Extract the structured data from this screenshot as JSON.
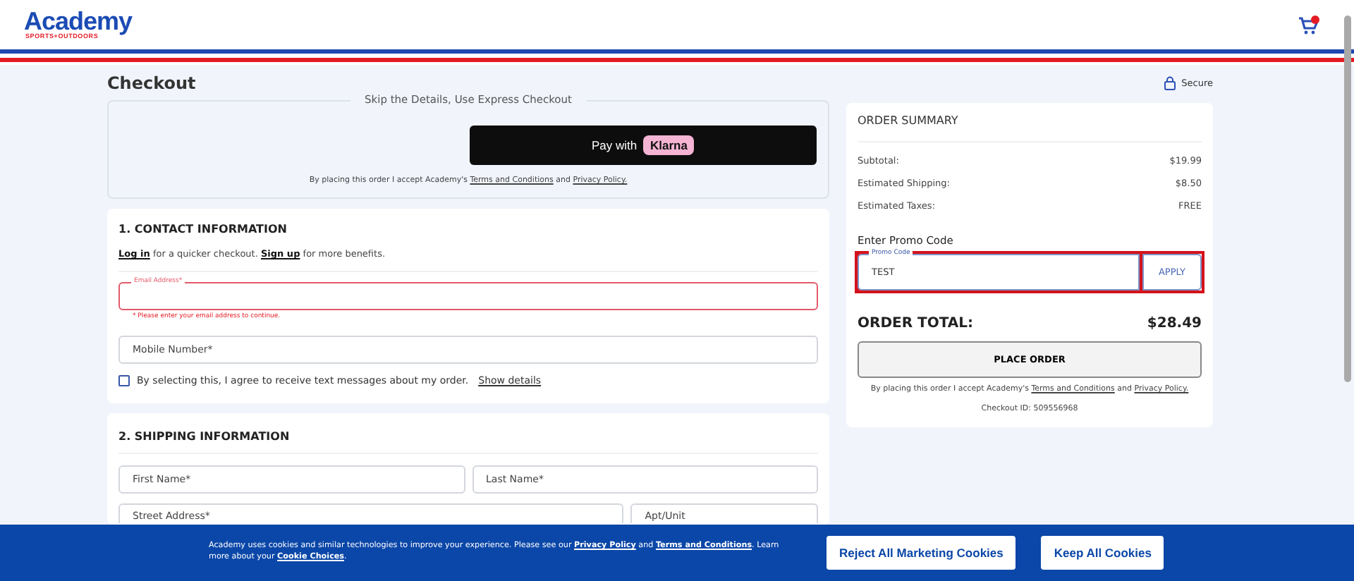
{
  "header": {
    "logo": "Academy",
    "logo_tagline": "SPORTS+OUTDOORS"
  },
  "page_title": "Checkout",
  "secure_label": "Secure",
  "express": {
    "legend": "Skip the Details, Use Express Checkout",
    "pay_label": "Pay with",
    "pay_brand": "Klarna",
    "legal_before": "By placing this order I accept Academy's",
    "terms": "Terms and Conditions",
    "and": "and",
    "privacy": "Privacy Policy."
  },
  "contact": {
    "heading": "1. CONTACT INFORMATION",
    "login": "Log in",
    "login_rest": "for a quicker checkout.",
    "signup": "Sign up",
    "signup_rest": "for more benefits.",
    "email": {
      "label": "Email Address*",
      "error": true,
      "error_text": "* Please enter your email address to continue."
    },
    "mobile": {
      "placeholder": "Mobile Number*"
    },
    "sms": {
      "label": "By selecting this, I agree to receive text messages about my order.",
      "checked": false,
      "details": "Show details"
    }
  },
  "shipping": {
    "heading": "2. SHIPPING INFORMATION",
    "rows": [
      [
        {
          "placeholder": "First Name*"
        },
        {
          "placeholder": "Last Name*"
        }
      ],
      [
        {
          "placeholder": "Street Address*"
        },
        {
          "placeholder": "Apt/Unit"
        }
      ]
    ]
  },
  "summary": {
    "title": "ORDER SUMMARY",
    "lines": [
      {
        "label": "Subtotal:",
        "value": "$19.99"
      },
      {
        "label": "Estimated Shipping:",
        "value": "$8.50"
      },
      {
        "label": "Estimated Taxes:",
        "value": "FREE"
      }
    ],
    "promo_heading": "Enter Promo Code",
    "promo_label": "Promo Code",
    "promo_value": "TEST",
    "apply": "APPLY",
    "total_label": "ORDER TOTAL:",
    "total_value": "$28.49",
    "place_order": "PLACE ORDER",
    "legal_before": "By placing this order I accept Academy's",
    "terms": "Terms and Conditions",
    "and": "and",
    "privacy": "Privacy Policy.",
    "checkout_id": "Checkout ID: 509556968"
  },
  "cookies": {
    "text_before": "Academy uses cookies and similar technologies to improve your experience. Please see our",
    "privacy": "Privacy Policy",
    "and": "and",
    "terms": "Terms and Conditions",
    "text_mid": ". Learn more about your",
    "choices": "Cookie Choices",
    "end": ".",
    "buttons": [
      "Reject All Marketing Cookies",
      "Keep All Cookies"
    ]
  }
}
